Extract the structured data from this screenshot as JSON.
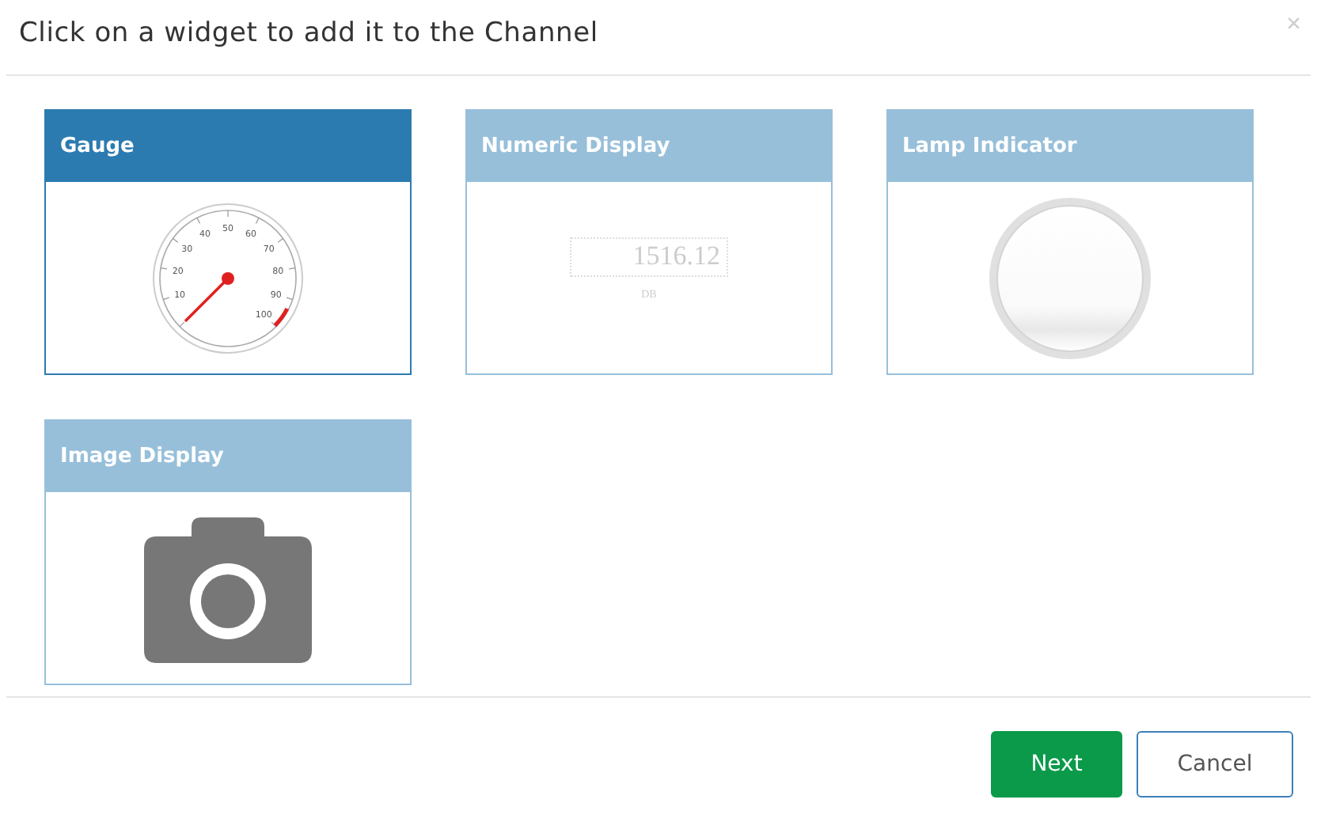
{
  "dialog": {
    "title": "Click on a widget to add it to the Channel",
    "close": "×"
  },
  "widgets": [
    {
      "kind": "gauge",
      "title": "Gauge",
      "selected": true,
      "labels": [
        "10",
        "20",
        "30",
        "40",
        "50",
        "60",
        "70",
        "80",
        "90",
        "100"
      ]
    },
    {
      "kind": "numeric",
      "title": "Numeric Display",
      "selected": false,
      "value": "1516.12",
      "unit": "DB"
    },
    {
      "kind": "lamp",
      "title": "Lamp Indicator",
      "selected": false
    },
    {
      "kind": "camera",
      "title": "Image Display",
      "selected": false
    }
  ],
  "buttons": [
    {
      "kind": "primary",
      "label": "Next"
    },
    {
      "kind": "secondary",
      "label": "Cancel"
    }
  ]
}
